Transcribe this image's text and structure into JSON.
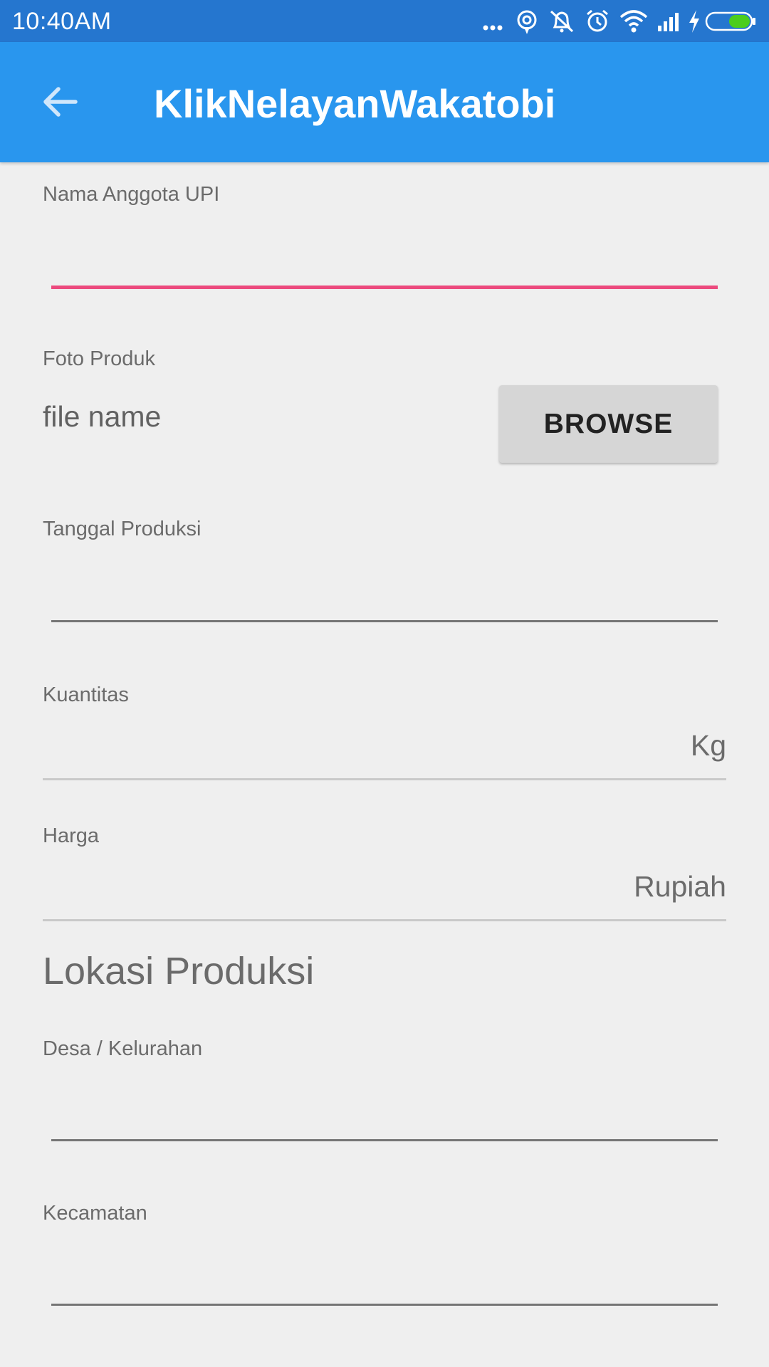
{
  "status_bar": {
    "time": "10:40AM",
    "icons": [
      "more-dots-icon",
      "hotspot-icon",
      "muted-bell-icon",
      "alarm-icon",
      "wifi-icon",
      "signal-icon",
      "charging-icon",
      "battery-icon"
    ],
    "background": "#2576cf"
  },
  "app_bar": {
    "title": "KlikNelayanWakatobi",
    "back_icon": "arrow-back-icon",
    "background": "#2996ee"
  },
  "form": {
    "nama_anggota": {
      "label": "Nama Anggota UPI",
      "value": ""
    },
    "foto_produk": {
      "label": "Foto Produk",
      "file_name": "file name",
      "browse_label": "BROWSE"
    },
    "tanggal_produksi": {
      "label": "Tanggal Produksi",
      "value": ""
    },
    "kuantitas": {
      "label": "Kuantitas",
      "value": "",
      "unit": "Kg"
    },
    "harga": {
      "label": "Harga",
      "value": "",
      "unit": "Rupiah"
    },
    "lokasi_section_title": "Lokasi Produksi",
    "desa": {
      "label": "Desa / Kelurahan",
      "value": ""
    },
    "kecamatan": {
      "label": "Kecamatan",
      "value": ""
    }
  },
  "colors": {
    "accent_active": "#ec4a7e",
    "page_background": "#efefef"
  }
}
